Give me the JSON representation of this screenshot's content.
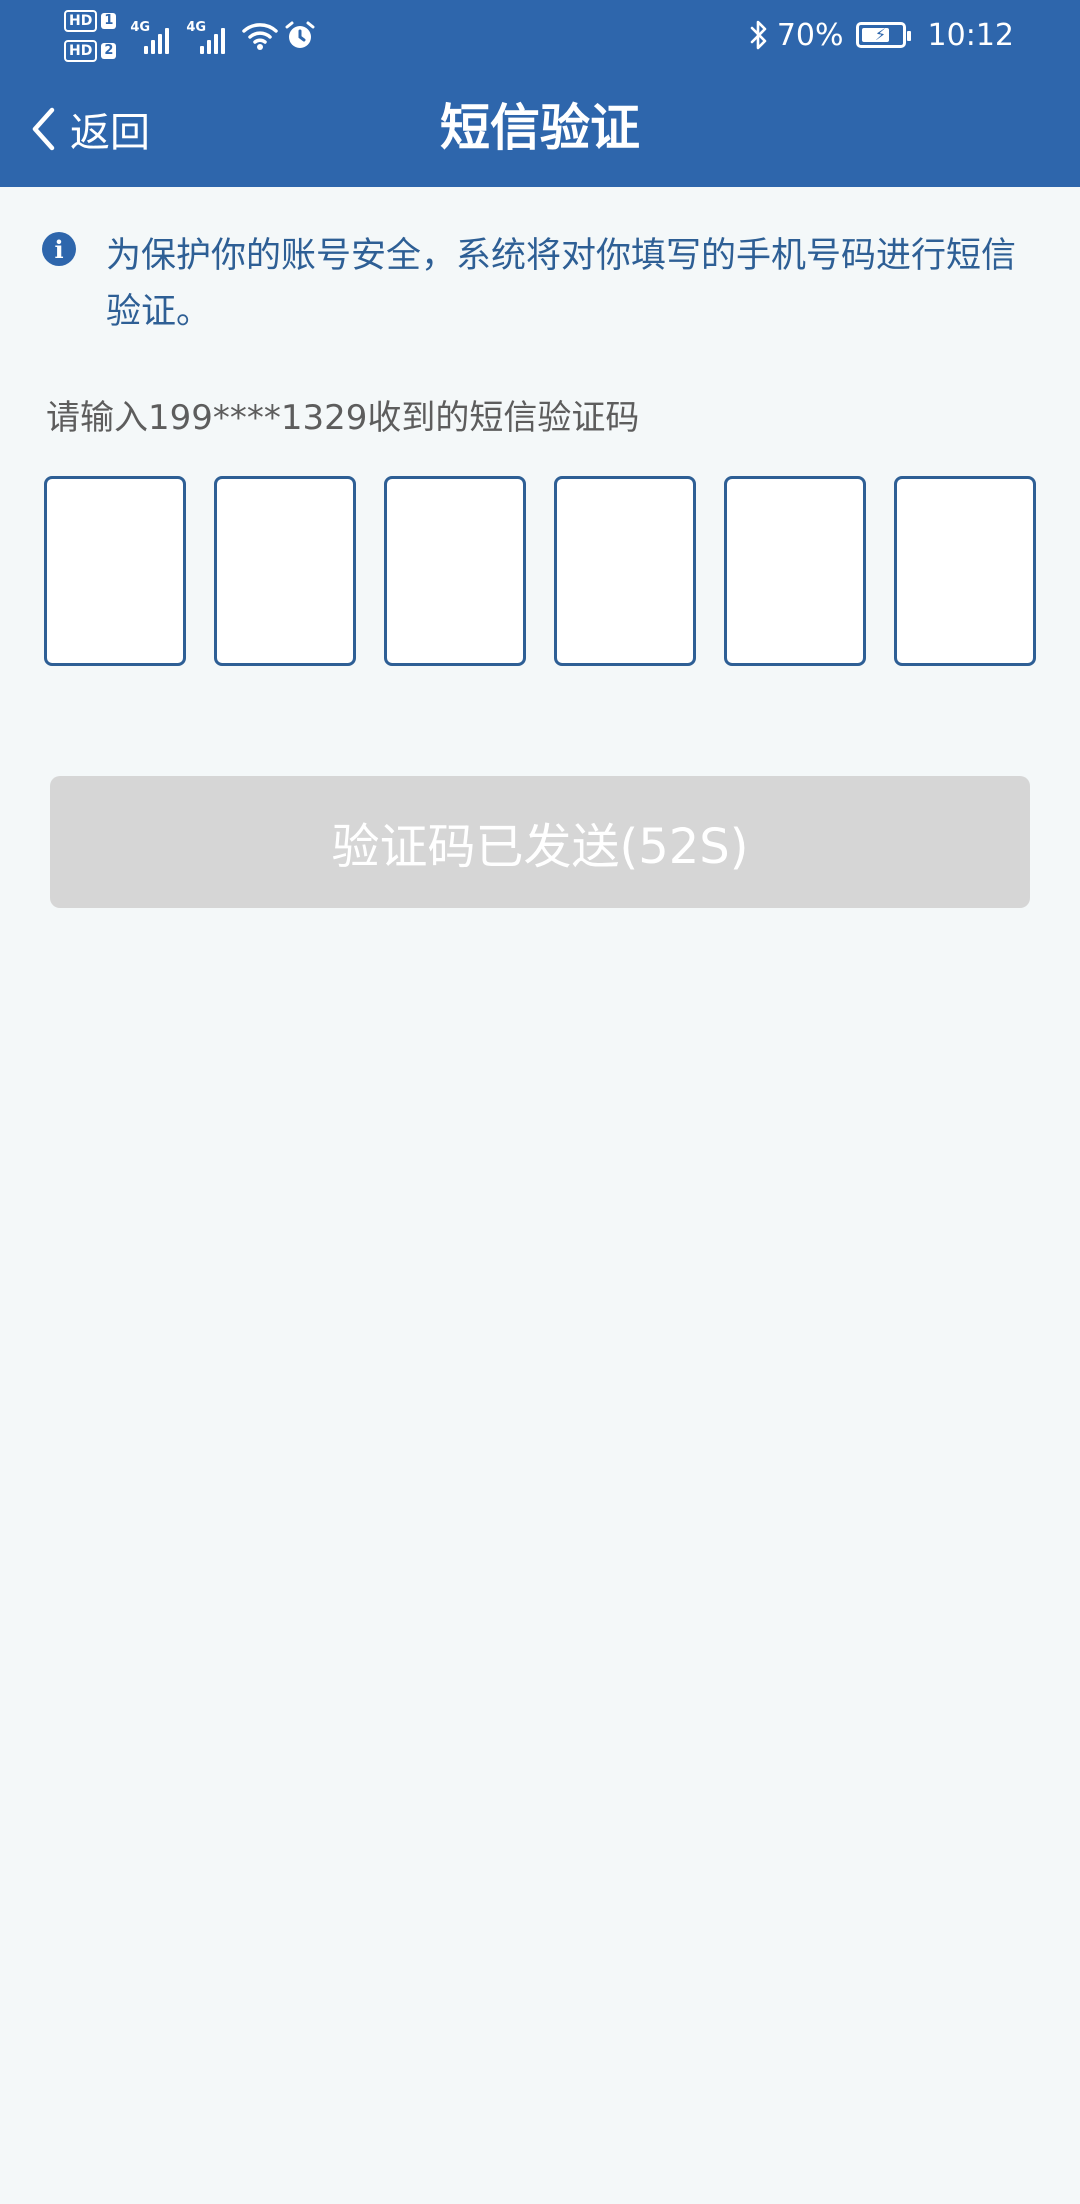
{
  "status_bar": {
    "sim1": "HD",
    "sim1_num": "1",
    "sim2": "HD",
    "sim2_num": "2",
    "net1": "4G",
    "net2": "4G",
    "battery_percent": "70%",
    "battery_level": 0.7,
    "time": "10:12",
    "icons": [
      "signal-icon",
      "signal-icon",
      "wifi-icon",
      "alarm-icon",
      "bluetooth-icon",
      "battery-charging-icon"
    ]
  },
  "nav": {
    "back_label": "返回",
    "title": "短信验证"
  },
  "notice": {
    "icon": "info-icon",
    "text": "为保护你的账号安全，系统将对你填写的手机号码进行短信验证。"
  },
  "prompt": "请输入199****1329收到的短信验证码",
  "code_inputs": [
    "",
    "",
    "",
    "",
    "",
    ""
  ],
  "send_button": {
    "label": "验证码已发送(52S)",
    "disabled": true
  },
  "colors": {
    "header_bg": "#2e66ac",
    "page_bg": "#f4f8f9",
    "notice_text": "#2e5f95",
    "box_border": "#2e5f95",
    "button_disabled_bg": "#d6d6d6"
  }
}
